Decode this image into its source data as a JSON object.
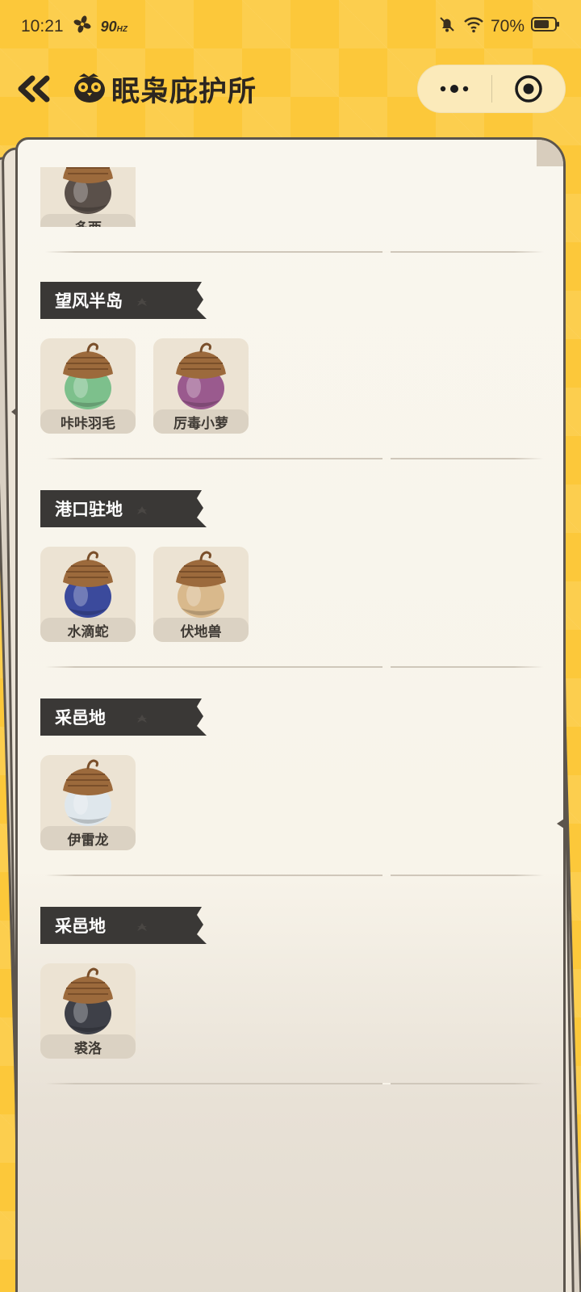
{
  "status_bar": {
    "time": "10:21",
    "refresh_rate": "90",
    "refresh_unit": "HZ",
    "battery": "70%"
  },
  "header": {
    "title": "眠枭庇护所"
  },
  "pets_top": [
    {
      "name": "多西",
      "body_color": "#5a504a"
    }
  ],
  "sections": [
    {
      "title": "望风半岛",
      "pets": [
        {
          "name": "咔咔羽毛",
          "body_color": "#7dc08c"
        },
        {
          "name": "厉毒小萝",
          "body_color": "#9a5a8e"
        }
      ]
    },
    {
      "title": "港口驻地",
      "pets": [
        {
          "name": "水滴蛇",
          "body_color": "#3b4a9c"
        },
        {
          "name": "伏地兽",
          "body_color": "#d9b98c"
        }
      ]
    },
    {
      "title": "采邑地",
      "pets": [
        {
          "name": "伊雷龙",
          "body_color": "#dfe7ec"
        }
      ]
    },
    {
      "title": "采邑地",
      "pets": [
        {
          "name": "裘洛",
          "body_color": "#3e4048"
        }
      ]
    }
  ],
  "colors": {
    "background": "#fcc83a",
    "banner": "#3a3836",
    "paper": "#f9f6ee",
    "acorn_cap": "#9c6a3c"
  }
}
